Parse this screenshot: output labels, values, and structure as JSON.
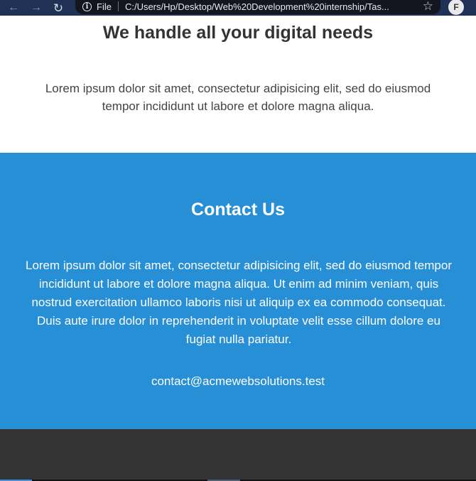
{
  "browser": {
    "back_icon": "←",
    "forward_icon": "→",
    "reload_icon": "↻",
    "info_icon": "i",
    "file_label": "File",
    "url": "C:/Users/Hp/Desktop/Web%20Development%20internship/Tas...",
    "star_icon": "☆",
    "avatar_initial": "F"
  },
  "services": {
    "heading": "We handle all your digital needs",
    "text": "Lorem ipsum dolor sit amet, consectetur adipisicing elit, sed do eiusmod tempor incididunt ut labore et dolore magna aliqua."
  },
  "contact": {
    "heading": "Contact Us",
    "text": "Lorem ipsum dolor sit amet, consectetur adipisicing elit, sed do eiusmod tempor incididunt ut labore et dolore magna aliqua. Ut enim ad minim veniam, quis nostrud exercitation ullamco laboris nisi ut aliquip ex ea commodo consequat. Duis aute irure dolor in reprehenderit in voluptate velit esse cillum dolore eu fugiat nulla pariatur.",
    "email": "contact@acmewebsolutions.test"
  },
  "colors": {
    "browser_bar": "#1f3154",
    "contact_bg": "#268fd5",
    "footer_bg": "#333333"
  }
}
